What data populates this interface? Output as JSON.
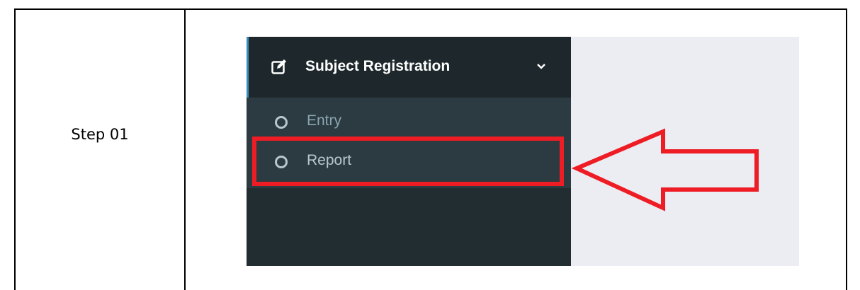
{
  "document": {
    "step_label": "Step 01"
  },
  "sidebar": {
    "menu_title": "Subject Registration",
    "menu_icon": "edit-icon",
    "expand_icon": "chevron-down-icon",
    "items": [
      {
        "label": "Entry",
        "icon": "circle-icon"
      },
      {
        "label": "Report",
        "icon": "circle-icon"
      }
    ]
  },
  "annotation": {
    "highlight_color": "#ee1c24",
    "highlighted_item": "Report",
    "arrow_icon": "arrow-left-icon"
  },
  "colors": {
    "sidebar_bg": "#222d32",
    "header_bg": "#1e282c",
    "submenu_bg": "#2c3b41",
    "accent": "#3c8dbc",
    "content_bg": "#ecedf2"
  }
}
